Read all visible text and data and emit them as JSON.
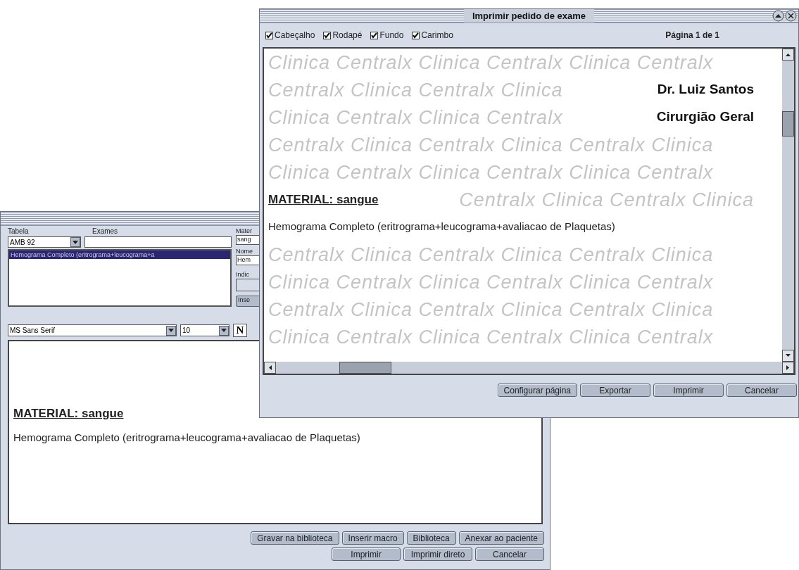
{
  "back_window": {
    "tabela": {
      "label": "Tabela",
      "value": "AMB 92"
    },
    "exames": {
      "label": "Exames"
    },
    "exam_list": [
      {
        "text": "Hemograma Completo (eritrograma+leucograma+a",
        "selected": true
      }
    ],
    "right_column": {
      "material_label": "Mater",
      "material_value": "sang",
      "nome_label": "Nome",
      "nome_value": "Hem",
      "indicacao_label": "Indic",
      "insert_button": "Inse"
    },
    "font": {
      "family": "MS Sans Serif",
      "size": "10",
      "bold_button": "N"
    },
    "editor": {
      "heading": "MATERIAL: sangue",
      "body": "Hemograma Completo (eritrograma+leucograma+avaliacao de Plaquetas)"
    },
    "buttons_row1": [
      "Gravar na biblioteca",
      "Inserir macro",
      "Biblioteca",
      "Anexar ao paciente"
    ],
    "buttons_row2": [
      "Imprimir",
      "Imprimir direto",
      "Cancelar"
    ]
  },
  "print_window": {
    "title": "Imprimir pedido de exame",
    "options": [
      {
        "label": "Cabeçalho",
        "checked": true
      },
      {
        "label": "Rodapé",
        "checked": true
      },
      {
        "label": "Fundo",
        "checked": true
      },
      {
        "label": "Carimbo",
        "checked": true
      }
    ],
    "page_info": "Página 1 de 1",
    "preview_rows": [
      {
        "kind": "watermark",
        "watermark": "Clinica Centralx Clinica Centralx Clinica Centralx"
      },
      {
        "kind": "signature",
        "watermark": "Centralx Clinica Centralx Clinica",
        "text": "Dr. Luiz Santos"
      },
      {
        "kind": "signature",
        "watermark": "Clinica Centralx Clinica Centralx",
        "text": "Cirurgião Geral"
      },
      {
        "kind": "watermark",
        "watermark": "Centralx Clinica Centralx Clinica Centralx Clinica"
      },
      {
        "kind": "watermark",
        "watermark": "Clinica Centralx Clinica Centralx Clinica Centralx"
      },
      {
        "kind": "heading",
        "watermark": "Centralx Clinica Centralx Clinica",
        "text": "MATERIAL: sangue"
      },
      {
        "kind": "body",
        "text": "Hemograma Completo (eritrograma+leucograma+avaliacao de Plaquetas)"
      },
      {
        "kind": "watermark",
        "watermark": "Centralx Clinica Centralx Clinica Centralx Clinica"
      },
      {
        "kind": "watermark",
        "watermark": "Clinica Centralx Clinica Centralx Clinica Centralx"
      },
      {
        "kind": "watermark",
        "watermark": "Centralx Clinica Centralx Clinica Centralx Clinica"
      },
      {
        "kind": "watermark",
        "watermark": "Clinica Centralx Clinica Centralx Clinica Centralx"
      }
    ],
    "buttons": [
      "Configurar página",
      "Exportar",
      "Imprimir",
      "Cancelar"
    ]
  }
}
